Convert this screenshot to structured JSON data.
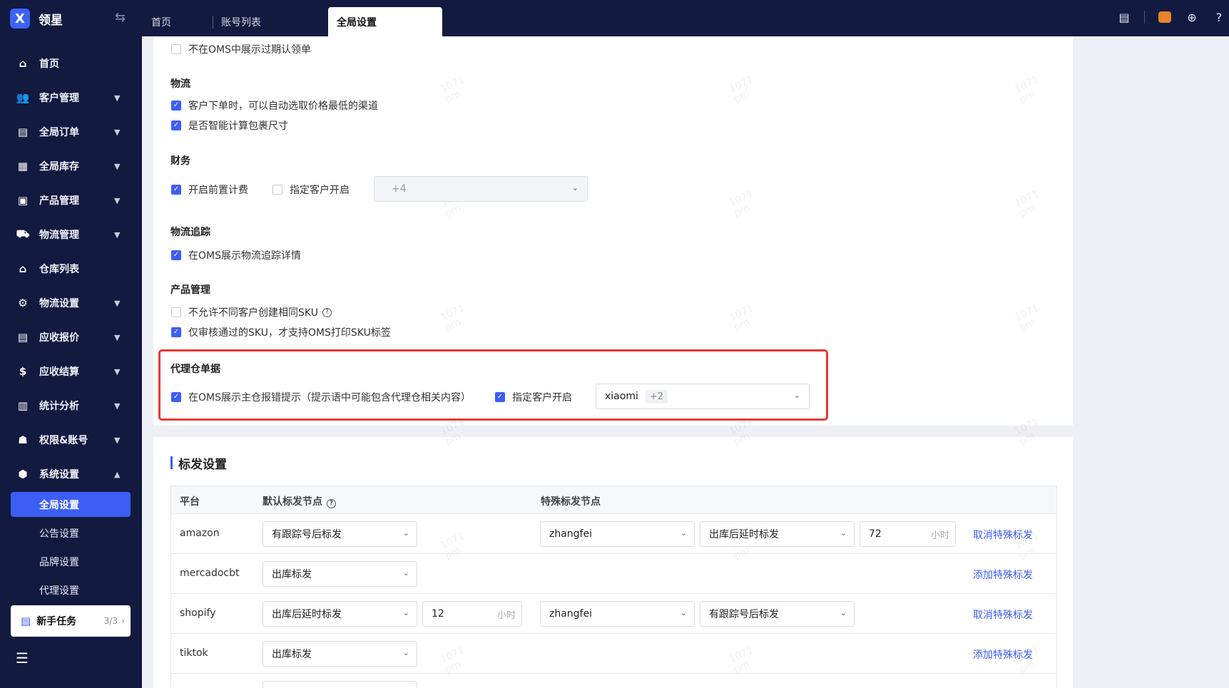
{
  "app": {
    "logo": "X",
    "name": "领星"
  },
  "tabs": [
    "首页",
    "账号列表",
    "全局设置"
  ],
  "sidebar": {
    "items": [
      {
        "label": "首页",
        "icon": "home-icon"
      },
      {
        "label": "客户管理",
        "icon": "users-icon"
      },
      {
        "label": "全局订单",
        "icon": "orders-icon"
      },
      {
        "label": "全局库存",
        "icon": "inventory-icon"
      },
      {
        "label": "产品管理",
        "icon": "product-icon"
      },
      {
        "label": "物流管理",
        "icon": "truck-icon"
      },
      {
        "label": "仓库列表",
        "icon": "warehouse-icon"
      },
      {
        "label": "物流设置",
        "icon": "logistics-settings-icon"
      },
      {
        "label": "应收报价",
        "icon": "quote-icon"
      },
      {
        "label": "应收结算",
        "icon": "dollar-icon"
      },
      {
        "label": "统计分析",
        "icon": "chart-icon"
      },
      {
        "label": "权限&账号",
        "icon": "org-icon"
      },
      {
        "label": "系统设置",
        "icon": "hexagon-settings-icon"
      }
    ],
    "sub_items": [
      "全局设置",
      "公告设置",
      "品牌设置",
      "代理设置"
    ],
    "newbie": {
      "label": "新手任务",
      "count": "3/3"
    }
  },
  "settings": {
    "top_row": "不在OMS中展示过期认领单",
    "logistics": {
      "title": "物流",
      "opt1": "客户下单时，可以自动选取价格最低的渠道",
      "opt2": "是否智能计算包裹尺寸"
    },
    "finance": {
      "title": "财务",
      "opt1": "开启前置计费",
      "opt2": "指定客户开启",
      "select_value": "+4"
    },
    "tracking": {
      "title": "物流追踪",
      "opt1": "在OMS展示物流追踪详情"
    },
    "product": {
      "title": "产品管理",
      "opt1": "不允许不同客户创建相同SKU",
      "opt2": "仅审核通过的SKU，才支持OMS打印SKU标签"
    },
    "proxy": {
      "title": "代理仓单据",
      "opt1": "在OMS展示主仓报错提示（提示语中可能包含代理仓相关内容）",
      "opt2": "指定客户开启",
      "select_value": "xiaomi",
      "select_more": "+2"
    }
  },
  "shipping": {
    "title": "标发设置",
    "headers": [
      "平台",
      "默认标发节点",
      "特殊标发节点"
    ],
    "rows": [
      {
        "platform": "amazon",
        "default": "有跟踪号后标发",
        "special_user": "zhangfei",
        "special_node": "出库后延时标发",
        "special_hours": "72",
        "unit": "小时",
        "action": "取消特殊标发"
      },
      {
        "platform": "mercadocbt",
        "default": "出库标发",
        "action": "添加特殊标发"
      },
      {
        "platform": "shopify",
        "default": "出库后延时标发",
        "default_hours": "12",
        "unit": "小时",
        "special_user": "zhangfei",
        "special_node": "有跟踪号后标发",
        "action": "取消特殊标发"
      },
      {
        "platform": "tiktok",
        "default": "出库标发",
        "action": "添加特殊标发"
      }
    ]
  },
  "watermark": {
    "line1": "1071",
    "line2": "pm"
  }
}
